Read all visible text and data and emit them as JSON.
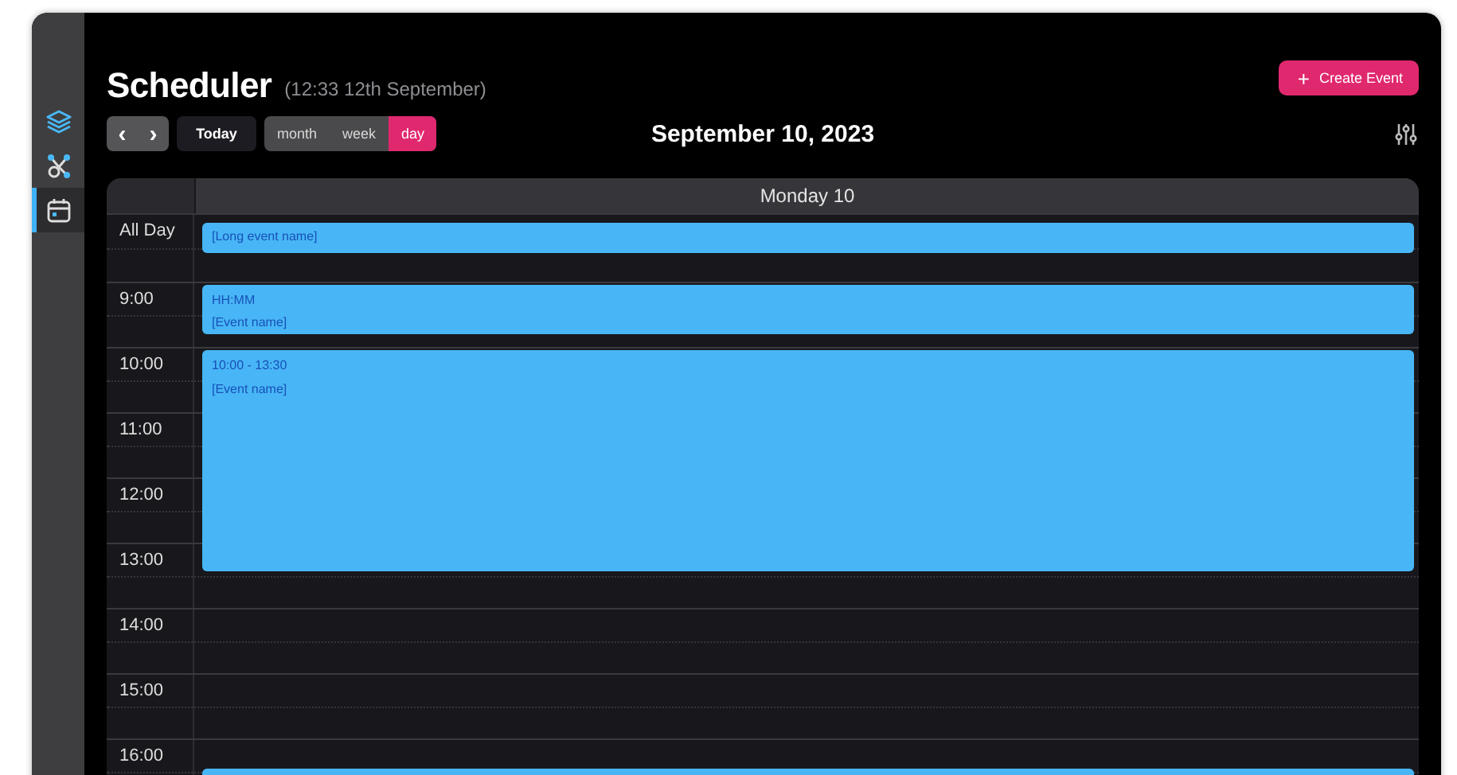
{
  "sidebar": {
    "items": [
      {
        "selected": false
      },
      {
        "selected": false
      },
      {
        "selected": true
      }
    ]
  },
  "header": {
    "title": "Scheduler",
    "subtitle": "(12:33 12th September)",
    "create_button": {
      "icon": "+",
      "label": "Create Event"
    }
  },
  "toolbar": {
    "prev": "‹",
    "next": "›",
    "today": "Today",
    "views": [
      {
        "label": "month",
        "selected": false
      },
      {
        "label": "week",
        "selected": false
      },
      {
        "label": "day",
        "selected": true
      }
    ],
    "date_title": "September 10, 2023"
  },
  "day_view": {
    "column_header": "Monday 10",
    "all_day": {
      "label": "All Day",
      "events": [
        {
          "name": "[Long event name]"
        }
      ]
    },
    "slots": [
      {
        "label": "9:00",
        "events": [
          {
            "kind": "short",
            "time": "HH:MM",
            "name": "[Event name]"
          }
        ]
      },
      {
        "label": "10:00",
        "events": [
          {
            "kind": "long",
            "time": "10:00 - 13:30",
            "name": "[Event name]"
          }
        ]
      },
      {
        "label": "11:00"
      },
      {
        "label": "12:00"
      },
      {
        "label": "13:00"
      },
      {
        "label": "14:00"
      },
      {
        "label": "15:00"
      },
      {
        "label": "16:00",
        "events": [
          {
            "kind": "half_past"
          }
        ]
      }
    ]
  }
}
